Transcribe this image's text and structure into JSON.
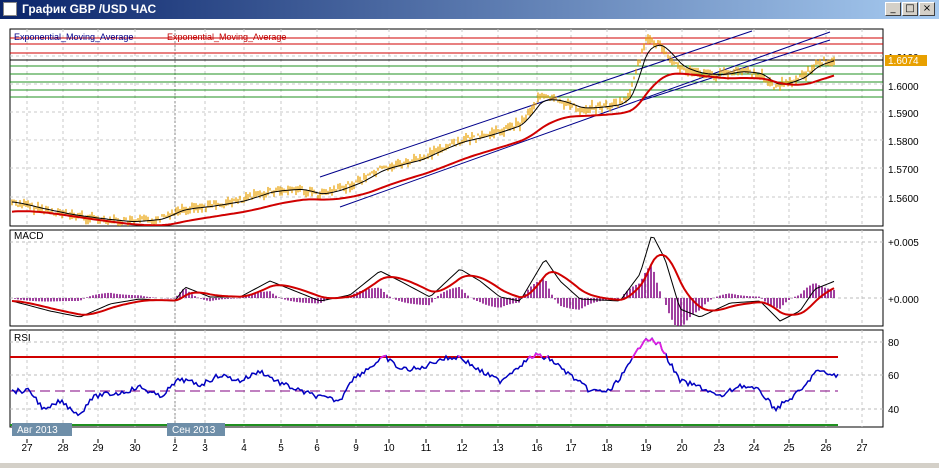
{
  "window": {
    "title": "График GBP /USD  ЧАС",
    "buttons": [
      "_",
      "□",
      "×"
    ]
  },
  "price_panel": {
    "indicator_labels": [
      "Exponential_Moving_Average",
      "Exponential_Moving_Average"
    ],
    "current_price": "1.6074",
    "axis_labels": [
      "1.6100",
      "1.6000",
      "1.5900",
      "1.5800",
      "1.5700",
      "1.5600"
    ]
  },
  "macd_panel": {
    "title": "MACD",
    "axis_labels": [
      "+0.005",
      "+0.000"
    ]
  },
  "rsi_panel": {
    "title": "RSI",
    "axis_labels": [
      "80",
      "60",
      "40"
    ]
  },
  "time_axis": {
    "month_labels": [
      "Авг 2013",
      "Сен 2013"
    ],
    "day_labels": [
      "27",
      "28",
      "29",
      "30",
      "2",
      "3",
      "4",
      "5",
      "6",
      "9",
      "10",
      "11",
      "12",
      "13",
      "16",
      "17",
      "18",
      "19",
      "20",
      "23",
      "24",
      "25",
      "26",
      "27"
    ]
  },
  "colors": {
    "price_bars": "#e8a000",
    "ema_fast": "#000000",
    "ema_slow": "#d00000",
    "channel": "#00008b",
    "level_red": "#d00000",
    "level_green": "#209020",
    "macd_line": "#000000",
    "signal_line": "#d00000",
    "histogram": "#800080",
    "rsi_line": "#0000c0",
    "rsi_overbought": "#e020e0"
  }
}
